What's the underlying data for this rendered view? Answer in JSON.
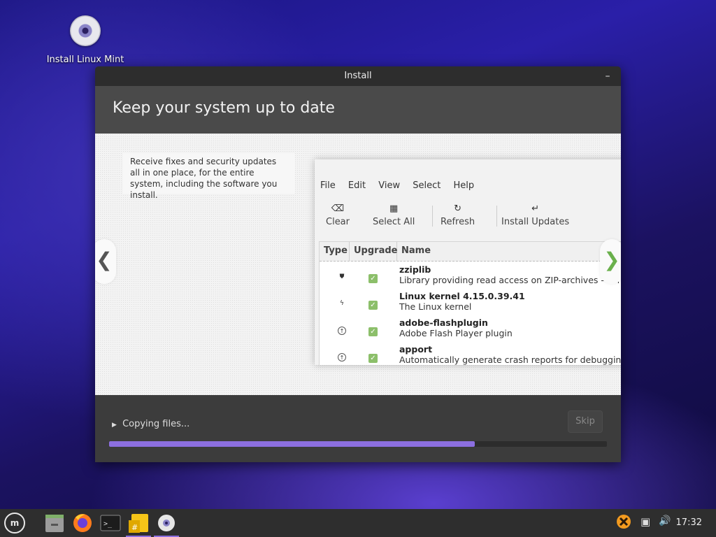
{
  "desktop": {
    "icon_label": "Install Linux Mint",
    "icon": "disc-icon"
  },
  "window": {
    "title": "Install",
    "minimize_glyph": "–",
    "heading": "Keep your system up to date"
  },
  "slide": {
    "description": "Receive fixes and security updates all in one place, for the entire system, including the software you install.",
    "prev_glyph": "❮",
    "next_glyph": "❯",
    "screenshot": {
      "menu": [
        "File",
        "Edit",
        "View",
        "Select",
        "Help"
      ],
      "toolbar": [
        {
          "icon": "⌫",
          "label": "Clear"
        },
        {
          "icon": "▦",
          "label": "Select All"
        },
        {
          "icon": "↻",
          "label": "Refresh"
        },
        {
          "icon": "↵",
          "label": "Install Updates"
        }
      ],
      "columns": [
        "Type",
        "Upgrade",
        "Name"
      ],
      "rows": [
        {
          "type_icon": "shield-icon",
          "type_glyph": "⛊",
          "name": "zziplib",
          "description": "Library providing read access on ZIP-archives - library"
        },
        {
          "type_icon": "lightning-icon",
          "type_glyph": "ϟ",
          "name": "Linux kernel 4.15.0.39.41",
          "description": "The Linux kernel"
        },
        {
          "type_icon": "up-arrow-icon",
          "type_glyph": "↑",
          "name": "adobe-flashplugin",
          "description": "Adobe Flash Player plugin"
        },
        {
          "type_icon": "up-arrow-icon",
          "type_glyph": "↑",
          "name": "apport",
          "description": "Automatically generate crash reports for debugging"
        }
      ],
      "check_glyph": "✓"
    }
  },
  "progress": {
    "status": "Copying files...",
    "status_glyph": "▶",
    "skip_label": "Skip",
    "fraction": 0.735
  },
  "taskbar": {
    "menu_glyph": "m",
    "items": [
      "file-manager-icon",
      "firefox-icon",
      "terminal-icon",
      "calculator-icon",
      "installer-disc-icon"
    ],
    "terminal_glyph": ">_",
    "calc_glyph": "#",
    "tray": {
      "network_glyph": "▣",
      "volume_glyph": "🔊",
      "update_glyph": "✖"
    },
    "clock": "17:32"
  },
  "colors": {
    "accent": "#8c6fe0",
    "check": "#8cbf6a",
    "next_arrow": "#6ab04c"
  }
}
